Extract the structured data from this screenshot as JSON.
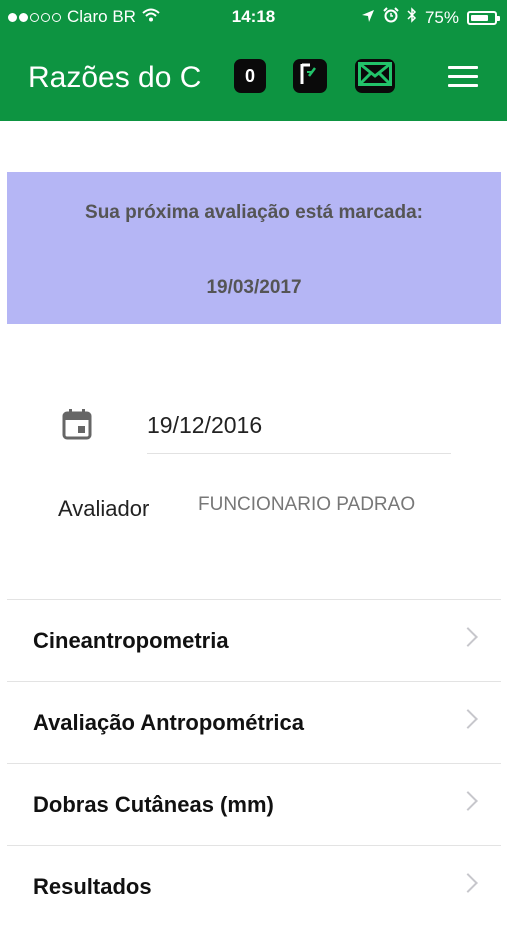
{
  "status_bar": {
    "carrier": "Claro BR",
    "time": "14:18",
    "battery_percent": "75%",
    "battery_level": 0.75,
    "signal_bars_filled": 2,
    "signal_bars_total": 5
  },
  "header": {
    "title": "Razões do C",
    "counter_badge": "0",
    "background_color": "#0d9441"
  },
  "notice": {
    "title": "Sua próxima avaliação está marcada:",
    "date": "19/03/2017",
    "background_color": "#b5b6f5"
  },
  "form": {
    "date_value": "19/12/2016",
    "evaluator_label": "Avaliador",
    "evaluator_value": "FUNCIONARIO PADRAO"
  },
  "menu": {
    "items": [
      {
        "label": "Cineantropometria"
      },
      {
        "label": "Avaliação Antropométrica"
      },
      {
        "label": "Dobras Cutâneas (mm)"
      },
      {
        "label": "Resultados"
      }
    ]
  },
  "icons": [
    "wifi-icon",
    "location-arrow-icon",
    "alarm-icon",
    "bluetooth-icon",
    "battery-icon",
    "calculator-icon",
    "mail-icon",
    "hamburger-menu-icon",
    "calendar-icon",
    "chevron-right-icon"
  ]
}
